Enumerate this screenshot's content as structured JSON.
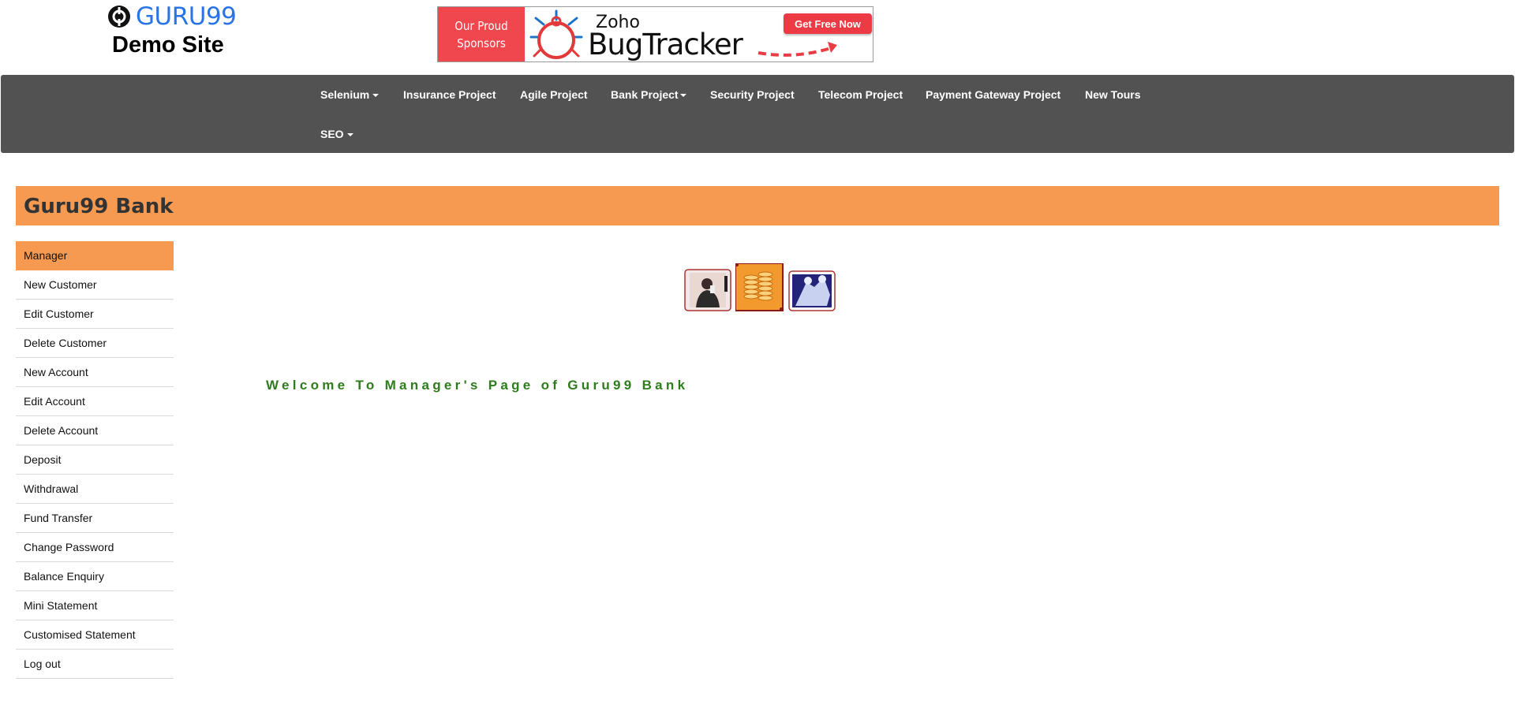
{
  "header": {
    "logo_text": "GURU99",
    "subtitle": "Demo Site",
    "sponsor": {
      "label_line1": "Our Proud",
      "label_line2": "Sponsors",
      "brand_small": "Zoho",
      "brand_large": "BugTracker",
      "cta": "Get Free Now"
    }
  },
  "nav": {
    "items": [
      {
        "label": "Selenium",
        "dropdown": true
      },
      {
        "label": "Insurance Project",
        "dropdown": false
      },
      {
        "label": "Agile Project",
        "dropdown": false
      },
      {
        "label": "Bank Project",
        "dropdown": true
      },
      {
        "label": "Security Project",
        "dropdown": false
      },
      {
        "label": "Telecom Project",
        "dropdown": false
      },
      {
        "label": "Payment Gateway Project",
        "dropdown": false
      },
      {
        "label": "New Tours",
        "dropdown": false
      },
      {
        "label": "SEO",
        "dropdown": true
      }
    ]
  },
  "bank": {
    "title": "Guru99 Bank"
  },
  "sidebar": {
    "items": [
      {
        "label": "Manager",
        "active": true
      },
      {
        "label": "New Customer"
      },
      {
        "label": "Edit Customer"
      },
      {
        "label": "Delete Customer"
      },
      {
        "label": "New Account"
      },
      {
        "label": "Edit Account"
      },
      {
        "label": "Delete Account"
      },
      {
        "label": "Deposit"
      },
      {
        "label": "Withdrawal"
      },
      {
        "label": "Fund Transfer"
      },
      {
        "label": "Change Password"
      },
      {
        "label": "Balance Enquiry"
      },
      {
        "label": "Mini Statement"
      },
      {
        "label": "Customised Statement"
      },
      {
        "label": "Log out"
      }
    ]
  },
  "main": {
    "welcome": "Welcome To Manager's Page of Guru99 Bank"
  },
  "colors": {
    "accent_orange": "#f79a51",
    "nav_bg": "#525252",
    "welcome_green": "#2e7d1c",
    "logo_blue": "#2a74e5"
  }
}
